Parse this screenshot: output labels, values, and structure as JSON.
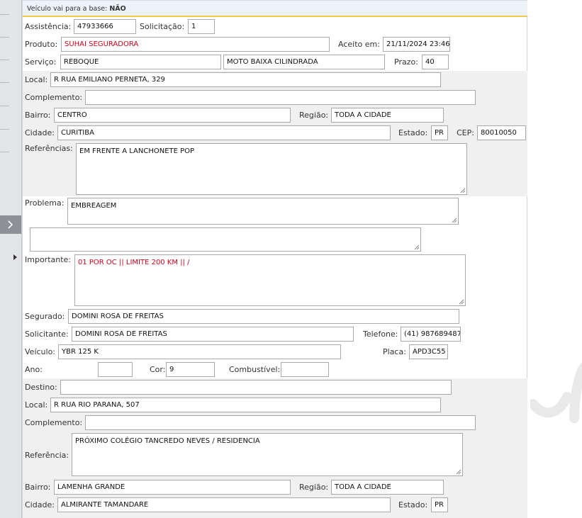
{
  "banner": {
    "label": "Veículo vai para a base:",
    "value": "NÃO"
  },
  "atendimento": {
    "assistencia_label": "Assistência:",
    "assistencia": "47933666",
    "solicitacao_label": "Solicitação:",
    "solicitacao": "1",
    "produto_label": "Produto:",
    "produto": "SUHAI SEGURADORA",
    "aceito_label": "Aceito em:",
    "aceito": "21/11/2024 23:46",
    "servico_label": "Serviço:",
    "servico": "REBOQUE",
    "servico_tipo": "MOTO BAIXA CILINDRADA",
    "prazo_label": "Prazo:",
    "prazo": "40"
  },
  "origem": {
    "local_label": "Local:",
    "local": "R RUA EMILIANO PERNETA, 329",
    "complemento_label": "Complemento:",
    "complemento": "",
    "bairro_label": "Bairro:",
    "bairro": "CENTRO",
    "regiao_label": "Região:",
    "regiao": "TODA A CIDADE",
    "cidade_label": "Cidade:",
    "cidade": "CURITIBA",
    "estado_label": "Estado:",
    "estado": "PR",
    "cep_label": "CEP:",
    "cep": "80010050",
    "referencias_label": "Referências:",
    "referencias": "EM FRENTE A LANCHONETE POP"
  },
  "problema": {
    "label": "Problema:",
    "value": "EMBREAGEM",
    "extra": "",
    "importante_label": "Importante:",
    "importante": "01 POR OC || LIMITE 200 KM ||   /"
  },
  "cliente": {
    "segurado_label": "Segurado:",
    "segurado": "DOMINI ROSA DE FREITAS",
    "solicitante_label": "Solicitante:",
    "solicitante": "DOMINI ROSA DE FREITAS",
    "telefone_label": "Telefone:",
    "telefone": "(41) 987689487",
    "veiculo_label": "Veículo:",
    "veiculo": "YBR 125 K",
    "placa_label": "Placa:",
    "placa": "APD3C55",
    "ano_label": "Ano:",
    "ano": "",
    "cor_label": "Cor:",
    "cor": "9",
    "combustivel_label": "Combustível:",
    "combustivel": ""
  },
  "destino": {
    "destino_label": "Destino:",
    "destino": "",
    "local_label": "Local:",
    "local": "R RUA RIO PARANA, 507",
    "complemento_label": "Complemento:",
    "complemento": "",
    "referencia_label": "Referência:",
    "referencia": "PRÓXIMO COLÉGIO TANCREDO NEVES / RESIDENCIA",
    "bairro_label": "Bairro:",
    "bairro": "LAMENHA GRANDE",
    "regiao_label": "Região:",
    "regiao": "TODA A CIDADE",
    "cidade_label": "Cidade:",
    "cidade": "ALMIRANTE TAMANDARE",
    "estado_label": "Estado:",
    "estado": "PR"
  },
  "icons": {
    "expand": "chevron-right-icon",
    "row_marker": "triangle-right-icon",
    "resize": "resize-grip-icon"
  },
  "colors": {
    "highlight_text": "#d0021b",
    "banner_border": "#f2c84b",
    "band_bg": "#f0f0f0"
  }
}
